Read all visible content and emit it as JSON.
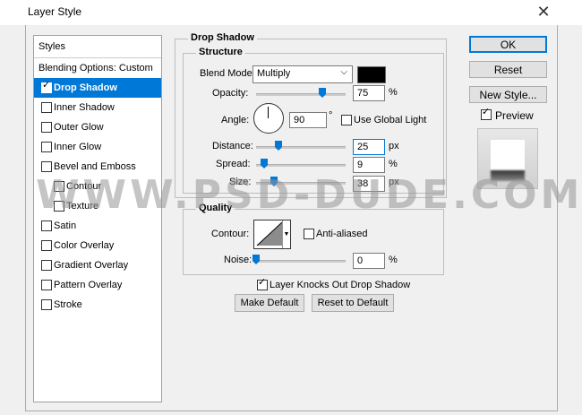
{
  "window": {
    "title": "Layer Style",
    "close_glyph": "✕"
  },
  "styles_list": {
    "header": "Styles",
    "blending": "Blending Options: Custom",
    "items": [
      {
        "label": "Drop Shadow",
        "checked": true,
        "selected": true
      },
      {
        "label": "Inner Shadow",
        "checked": false
      },
      {
        "label": "Outer Glow",
        "checked": false
      },
      {
        "label": "Inner Glow",
        "checked": false
      },
      {
        "label": "Bevel and Emboss",
        "checked": false
      },
      {
        "label": "Contour",
        "checked": false
      },
      {
        "label": "Texture",
        "checked": false
      },
      {
        "label": "Satin",
        "checked": false
      },
      {
        "label": "Color Overlay",
        "checked": false
      },
      {
        "label": "Gradient Overlay",
        "checked": false
      },
      {
        "label": "Pattern Overlay",
        "checked": false
      },
      {
        "label": "Stroke",
        "checked": false
      }
    ]
  },
  "drop_shadow": {
    "title": "Drop Shadow",
    "structure": {
      "legend": "Structure",
      "blend_mode_label": "Blend Mode:",
      "blend_mode_value": "Multiply",
      "color": "#000000",
      "opacity_label": "Opacity:",
      "opacity_value": "75",
      "opacity_unit": "%",
      "angle_label": "Angle:",
      "angle_value": "90",
      "angle_unit": "°",
      "global_light_label": "Use Global Light",
      "distance_label": "Distance:",
      "distance_value": "25",
      "distance_unit": "px",
      "spread_label": "Spread:",
      "spread_value": "9",
      "spread_unit": "%",
      "size_label": "Size:",
      "size_value": "38",
      "size_unit": "px"
    },
    "quality": {
      "legend": "Quality",
      "contour_label": "Contour:",
      "anti_aliased_label": "Anti-aliased",
      "noise_label": "Noise:",
      "noise_value": "0",
      "noise_unit": "%"
    },
    "knocks_out_label": "Layer Knocks Out Drop Shadow",
    "make_default": "Make Default",
    "reset_default": "Reset to Default"
  },
  "buttons": {
    "ok": "OK",
    "reset": "Reset",
    "new_style": "New Style...",
    "preview_label": "Preview"
  },
  "watermark": "WWW.PSD-DUDE.COM"
}
